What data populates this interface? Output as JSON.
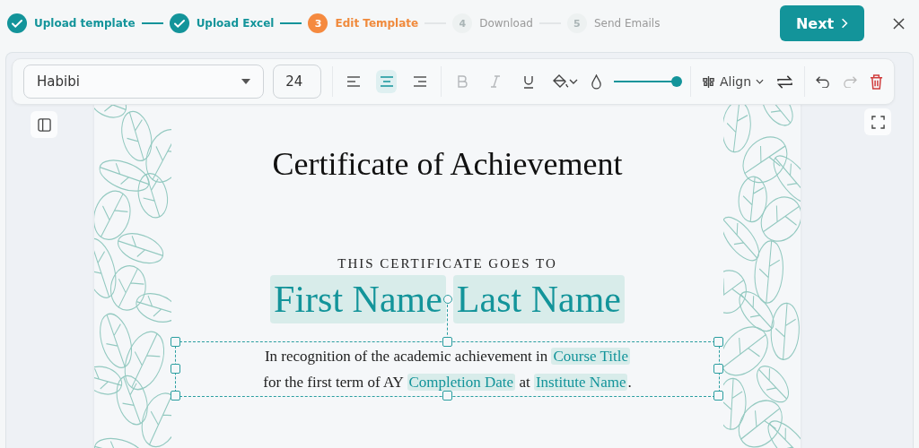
{
  "steps": [
    {
      "label": "Upload template",
      "done": true,
      "selected": false
    },
    {
      "label": "Upload Excel",
      "done": true,
      "selected": false
    },
    {
      "label": "Edit Template",
      "number": "3",
      "done": false,
      "selected": true
    },
    {
      "label": "Download",
      "number": "4",
      "done": false,
      "selected": false
    },
    {
      "label": "Send Emails",
      "number": "5",
      "done": false,
      "selected": false
    }
  ],
  "next_button": {
    "label": "Next"
  },
  "toolbar": {
    "font": {
      "value": "Habibi"
    },
    "size": {
      "value": "24"
    },
    "alignments": [
      {
        "kind": "left",
        "selected": false
      },
      {
        "kind": "center",
        "selected": true
      },
      {
        "kind": "right",
        "selected": false
      }
    ],
    "styles": [
      {
        "kind": "bold",
        "disabled": true
      },
      {
        "kind": "italic",
        "disabled": true
      },
      {
        "kind": "underline",
        "disabled": false
      }
    ],
    "opacity": {
      "level": 1
    },
    "align_menu": {
      "label": "Align"
    },
    "history": [
      {
        "kind": "undo",
        "disabled": false
      },
      {
        "kind": "redo",
        "disabled": true
      }
    ]
  },
  "certificate": {
    "title": "Certificate of Achievement",
    "subtitle": "THIS CERTIFICATE GOES TO",
    "name_fields": [
      "First Name",
      "Last Name"
    ],
    "body_lines": [
      [
        {
          "kind": "text",
          "text": "In recognition of the academic achievement in"
        },
        {
          "kind": "field",
          "text": "Course Title"
        }
      ],
      [
        {
          "kind": "text",
          "text": "for the first term of AY"
        },
        {
          "kind": "field",
          "text": "Completion Date"
        },
        {
          "kind": "text",
          "text": "at"
        },
        {
          "kind": "field",
          "text": "Institute Name"
        },
        {
          "kind": "text",
          "text": "."
        }
      ]
    ]
  }
}
